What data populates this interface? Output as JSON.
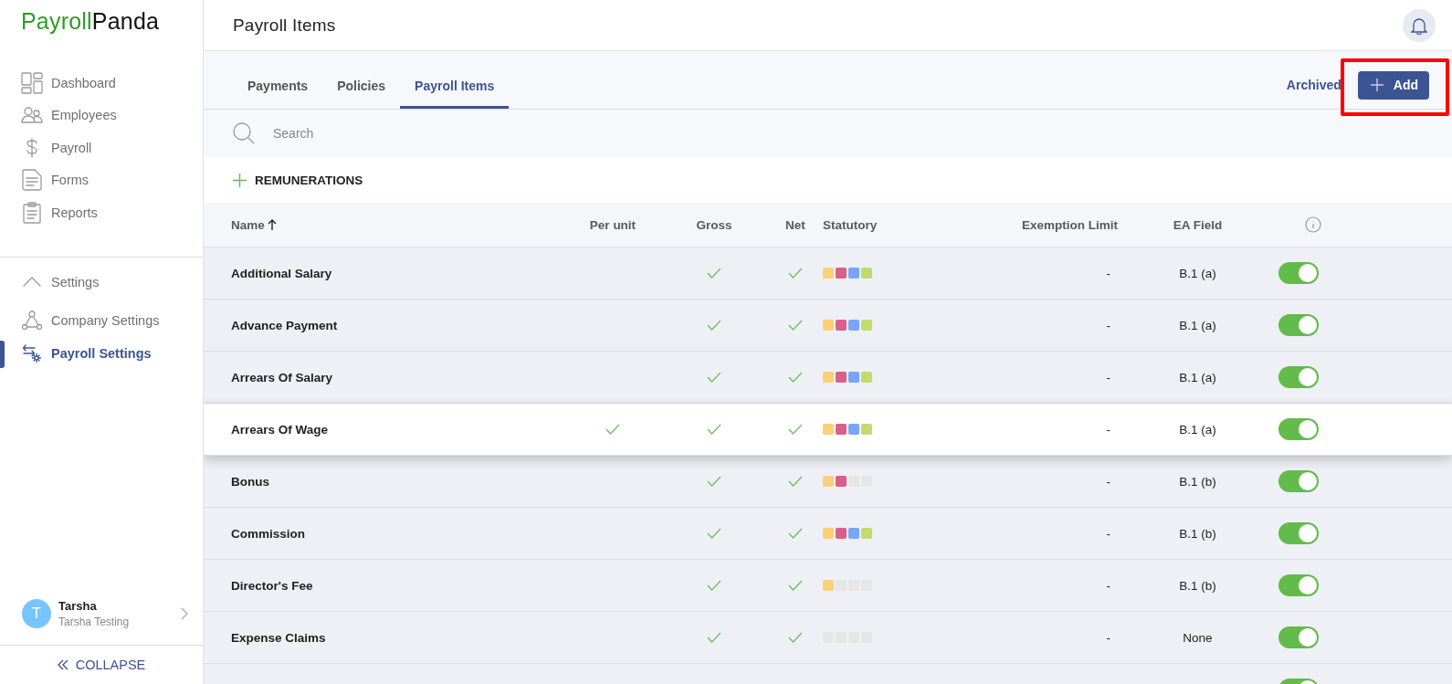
{
  "logo": {
    "primary": "Payroll",
    "secondary": "Panda"
  },
  "sidebar": {
    "nav": [
      {
        "label": "Dashboard",
        "selected": false
      },
      {
        "label": "Employees",
        "selected": false
      },
      {
        "label": "Payroll",
        "selected": false
      },
      {
        "label": "Forms",
        "selected": false
      },
      {
        "label": "Reports",
        "selected": false
      }
    ],
    "settings": {
      "label": "Settings",
      "expanded": true,
      "items": [
        {
          "label": "Company Settings",
          "selected": false
        },
        {
          "label": "Payroll Settings",
          "selected": true
        }
      ]
    },
    "user": {
      "initial": "T",
      "name": "Tarsha",
      "company": "Tarsha Testing"
    },
    "collapse": "COLLAPSE"
  },
  "page_title": "Payroll Items",
  "tabs": [
    {
      "label": "Payments",
      "selected": false
    },
    {
      "label": "Policies",
      "selected": false
    },
    {
      "label": "Payroll Items",
      "selected": true
    }
  ],
  "archived_link": "Archived",
  "add_button": {
    "label": "Add",
    "highlighted": true
  },
  "search": {
    "placeholder": "Search"
  },
  "section": {
    "title": "REMUNERATIONS"
  },
  "table": {
    "columns": [
      {
        "label": "Name",
        "sorted": true
      },
      {
        "label": "Per unit",
        "sorted": false
      },
      {
        "label": "Gross",
        "sorted": false
      },
      {
        "label": "Net",
        "sorted": false
      },
      {
        "label": "Statutory",
        "sorted": false
      },
      {
        "label": "Exemption Limit",
        "sorted": false
      },
      {
        "label": "EA Field",
        "sorted": false
      }
    ],
    "statutory_types": [
      {
        "color": "#fdd076"
      },
      {
        "color": "#d9608a"
      },
      {
        "color": "#78a6f5"
      },
      {
        "color": "#c0db70"
      }
    ],
    "rows": [
      {
        "name": "Additional Salary",
        "per_unit": false,
        "gross": true,
        "net": true,
        "statutory": [
          true,
          true,
          true,
          true
        ],
        "exemption_limit": "-",
        "ea_field": "B.1 (a)",
        "enabled": true,
        "hovered": false
      },
      {
        "name": "Advance Payment",
        "per_unit": false,
        "gross": true,
        "net": true,
        "statutory": [
          true,
          true,
          true,
          true
        ],
        "exemption_limit": "-",
        "ea_field": "B.1 (a)",
        "enabled": true,
        "hovered": false
      },
      {
        "name": "Arrears Of Salary",
        "per_unit": false,
        "gross": true,
        "net": true,
        "statutory": [
          true,
          true,
          true,
          true
        ],
        "exemption_limit": "-",
        "ea_field": "B.1 (a)",
        "enabled": true,
        "hovered": false
      },
      {
        "name": "Arrears Of Wage",
        "per_unit": true,
        "gross": true,
        "net": true,
        "statutory": [
          true,
          true,
          true,
          true
        ],
        "exemption_limit": "-",
        "ea_field": "B.1 (a)",
        "enabled": true,
        "hovered": true
      },
      {
        "name": "Bonus",
        "per_unit": false,
        "gross": true,
        "net": true,
        "statutory": [
          true,
          true,
          false,
          false
        ],
        "exemption_limit": "-",
        "ea_field": "B.1 (b)",
        "enabled": true,
        "hovered": false
      },
      {
        "name": "Commission",
        "per_unit": false,
        "gross": true,
        "net": true,
        "statutory": [
          true,
          true,
          true,
          true
        ],
        "exemption_limit": "-",
        "ea_field": "B.1 (b)",
        "enabled": true,
        "hovered": false
      },
      {
        "name": "Director's Fee",
        "per_unit": false,
        "gross": true,
        "net": true,
        "statutory": [
          true,
          false,
          false,
          false
        ],
        "exemption_limit": "-",
        "ea_field": "B.1 (b)",
        "enabled": true,
        "hovered": false
      },
      {
        "name": "Expense Claims",
        "per_unit": false,
        "gross": true,
        "net": true,
        "statutory": [
          false,
          false,
          false,
          false
        ],
        "exemption_limit": "-",
        "ea_field": "None",
        "enabled": true,
        "hovered": false
      },
      {
        "enabled": true,
        "hovered": false
      }
    ]
  }
}
